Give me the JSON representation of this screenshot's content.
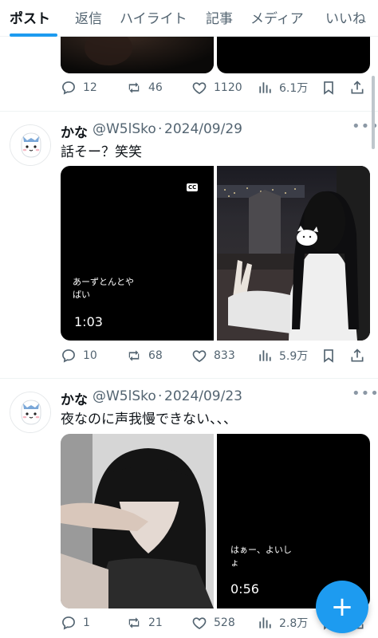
{
  "tabs": [
    {
      "label": "ポスト",
      "active": true
    },
    {
      "label": "返信"
    },
    {
      "label": "ハイライト"
    },
    {
      "label": "記事"
    },
    {
      "label": "メディア"
    },
    {
      "label": "いいね"
    }
  ],
  "posts": [
    {
      "replies": "12",
      "reposts": "46",
      "likes": "1120",
      "views": "6.1万"
    },
    {
      "name": "かな",
      "handle": "@W5lSko",
      "date": "2024/09/29",
      "text": "話そー？笑笑",
      "video_caption": "あーずとんとや\nばい",
      "duration": "1:03",
      "cc_label": "CC",
      "replies": "10",
      "reposts": "68",
      "likes": "833",
      "views": "5.9万"
    },
    {
      "name": "かな",
      "handle": "@W5lSko",
      "date": "2024/09/23",
      "text": "夜なのに声我慢できない、、、",
      "video_caption": "はぁー、よいし\nょ",
      "duration": "0:56",
      "replies": "1",
      "reposts": "21",
      "likes": "528",
      "views": "2.8万"
    }
  ],
  "colors": {
    "accent": "#1d9bf0",
    "text": "#0f1419",
    "secondary": "#536471"
  }
}
